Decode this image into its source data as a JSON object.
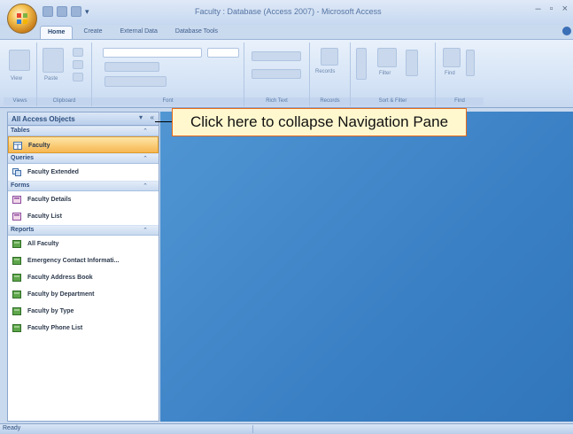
{
  "window": {
    "title": "Faculty : Database (Access 2007) - Microsoft Access",
    "controls": [
      "–",
      "▫",
      "×"
    ]
  },
  "ribbon": {
    "tabs": [
      "Home",
      "Create",
      "External Data",
      "Database Tools"
    ],
    "groups": [
      "Views",
      "Clipboard",
      "Font",
      "Rich Text",
      "Records",
      "Sort & Filter",
      "Find"
    ],
    "buttons": {
      "view": "View",
      "paste": "Paste",
      "records": "Records",
      "filter": "Filter",
      "find": "Find"
    }
  },
  "nav": {
    "title": "All Access Objects",
    "sections": [
      {
        "label": "Tables",
        "items": [
          "Faculty"
        ]
      },
      {
        "label": "Queries",
        "items": [
          "Faculty Extended"
        ]
      },
      {
        "label": "Forms",
        "items": [
          "Faculty Details",
          "Faculty List"
        ]
      },
      {
        "label": "Reports",
        "items": [
          "All Faculty",
          "Emergency Contact Informati...",
          "Faculty Address Book",
          "Faculty by Department",
          "Faculty by Type",
          "Faculty Phone List"
        ]
      }
    ]
  },
  "callout": {
    "text": "Click here to collapse Navigation Pane"
  },
  "status": {
    "text": "Ready"
  },
  "colors": {
    "accent": "#3a80c4",
    "callout_border": "#e86a1a",
    "selected": "#f7b751"
  }
}
